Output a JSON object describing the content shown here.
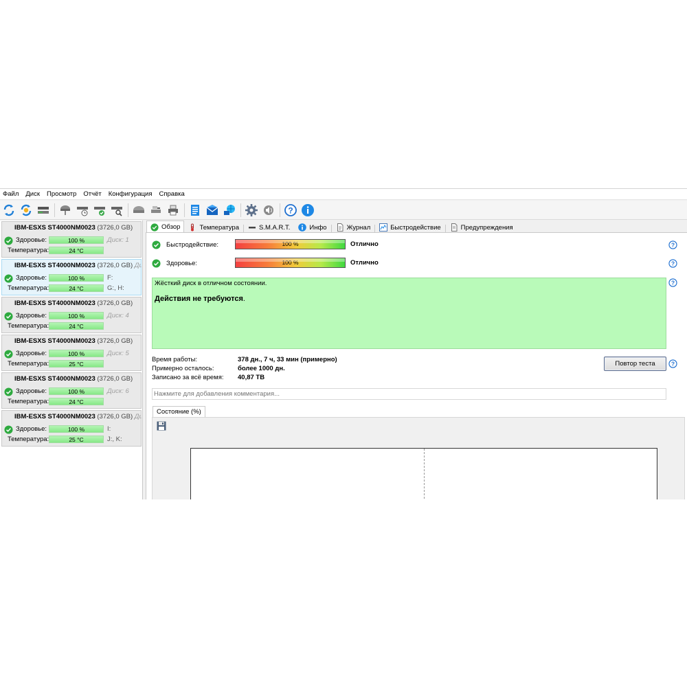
{
  "menu": [
    "Файл",
    "Диск",
    "Просмотр",
    "Отчёт",
    "Конфигурация",
    "Справка"
  ],
  "toolbar": {
    "icons": [
      "refresh-icon",
      "refresh-all-icon",
      "disk-icon",
      "hdd-icon",
      "hdd-clock-icon",
      "hdd-check-icon",
      "hdd-search-icon",
      "hdd-gray-icon",
      "hdd-tools-icon",
      "printer-icon",
      "clipboard-icon",
      "mail-icon",
      "network-icon",
      "settings-icon",
      "sound-icon",
      "help-icon",
      "info-icon"
    ]
  },
  "disks": [
    {
      "name": "IBM-ESXS ST4000NM0023",
      "size": "(3726,0 GB)",
      "note": "",
      "health_label": "Здоровье:",
      "health": "100 %",
      "health_pct": 100,
      "temp_label": "Температура:",
      "temp": "24 °C",
      "extra1": "Диск: 1",
      "extra2": "",
      "extra1_muted": true
    },
    {
      "name": "IBM-ESXS ST4000NM0023",
      "size": "(3726,0 GB)",
      "note": "Диск",
      "health_label": "Здоровье:",
      "health": "100 %",
      "health_pct": 100,
      "temp_label": "Температура:",
      "temp": "24 °C",
      "extra1": "F:",
      "extra2": "G:, H:",
      "extra1_muted": false
    },
    {
      "name": "IBM-ESXS ST4000NM0023",
      "size": "(3726,0 GB)",
      "note": "",
      "health_label": "Здоровье:",
      "health": "100 %",
      "health_pct": 100,
      "temp_label": "Температура:",
      "temp": "24 °C",
      "extra1": "Диск: 4",
      "extra2": "",
      "extra1_muted": true
    },
    {
      "name": "IBM-ESXS ST4000NM0023",
      "size": "(3726,0 GB)",
      "note": "",
      "health_label": "Здоровье:",
      "health": "100 %",
      "health_pct": 100,
      "temp_label": "Температура:",
      "temp": "25 °C",
      "extra1": "Диск: 5",
      "extra2": "",
      "extra1_muted": true
    },
    {
      "name": "IBM-ESXS ST4000NM0023",
      "size": "(3726,0 GB)",
      "note": "",
      "health_label": "Здоровье:",
      "health": "100 %",
      "health_pct": 100,
      "temp_label": "Температура:",
      "temp": "24 °C",
      "extra1": "Диск: 6",
      "extra2": "",
      "extra1_muted": true
    },
    {
      "name": "IBM-ESXS ST4000NM0023",
      "size": "(3726,0 GB)",
      "note": "Диск",
      "health_label": "Здоровье:",
      "health": "100 %",
      "health_pct": 100,
      "temp_label": "Температура:",
      "temp": "25 °C",
      "extra1": "I:",
      "extra2": "J:, K:",
      "extra1_muted": false
    }
  ],
  "tabs": [
    {
      "label": "Обзор",
      "icon": "check-circle-icon",
      "active": true
    },
    {
      "label": "Температура",
      "icon": "thermometer-icon",
      "active": false
    },
    {
      "label": "S.M.A.R.T.",
      "icon": "smart-icon",
      "active": false
    },
    {
      "label": "Инфо",
      "icon": "info-icon",
      "active": false
    },
    {
      "label": "Журнал",
      "icon": "document-icon",
      "active": false
    },
    {
      "label": "Быстродействие",
      "icon": "performance-chart-icon",
      "active": false
    },
    {
      "label": "Предупреждения",
      "icon": "warning-icon",
      "active": false
    }
  ],
  "overview": {
    "performance_label": "Быстродействие:",
    "performance_value": "100 %",
    "performance_pct": 100,
    "performance_status": "Отлично",
    "health_label": "Здоровье:",
    "health_value": "100 %",
    "health_pct": 100,
    "health_status": "Отлично",
    "message_line1": "Жёсткий диск в отличном состоянии.",
    "message_line2_bold": "Действия не требуются",
    "message_line2_tail": ".",
    "uptime_label": "Время работы:",
    "uptime_value": "378 дн., 7 ч, 33 мин (примерно)",
    "remaining_label": "Примерно осталось:",
    "remaining_value": "более 1000 дн.",
    "written_label": "Записано за всё время:",
    "written_value": "40,87 TB",
    "retest_button": "Повтор теста",
    "comment_placeholder": "Нажмите для добавления комментария...",
    "state_tab": "Состояние (%)"
  },
  "colors": {
    "good_green": "#b9fab9",
    "bar_green": "#87e887",
    "selected_card": "#e6f4fb",
    "info_blue": "#1e88e5"
  }
}
